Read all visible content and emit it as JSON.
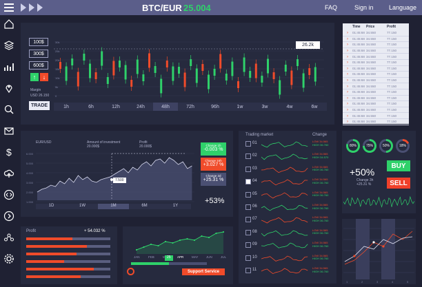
{
  "header": {
    "pair": "BTC/EUR",
    "price": "25.004",
    "nav": [
      "FAQ",
      "Sign in",
      "Language"
    ],
    "icons": [
      "menu-icon",
      "play-arrows-icon"
    ]
  },
  "sidebar": {
    "icons": [
      "home-icon",
      "layers-icon",
      "bar-chart-icon",
      "map-pin-icon",
      "search-icon",
      "mail-icon",
      "dollar-icon",
      "cloud-upload-icon",
      "code-icon",
      "chevron-right-icon",
      "share-icon",
      "gear-icon"
    ]
  },
  "trade_panel": {
    "amounts": [
      "100$",
      "300$",
      "600$"
    ],
    "margin_label": "Margin",
    "margin_value": "USD 26.150",
    "trade_label": "TRADE",
    "price_tag": "26.2k",
    "timeframes": [
      "1h",
      "6h",
      "12h",
      "24h",
      "48h",
      "72h",
      "96h",
      "1w",
      "3w",
      "4w",
      "6w"
    ],
    "selected_timeframe": "48h",
    "y_ticks": [
      "30k",
      "25k",
      "20k",
      "15k",
      "10k",
      "5k",
      "0"
    ]
  },
  "price_table": {
    "headers": [
      "Time",
      "Price",
      "Profit"
    ],
    "rows": [
      [
        "01:45:68",
        "34.550",
        "77.150"
      ],
      [
        "01:45:68",
        "34.550",
        "77.150"
      ],
      [
        "01:45:68",
        "34.550",
        "77.150"
      ],
      [
        "01:45:68",
        "34.550",
        "77.150"
      ],
      [
        "01:45:68",
        "34.550",
        "77.150"
      ],
      [
        "01:45:68",
        "34.550",
        "77.150"
      ],
      [
        "01:45:68",
        "34.550",
        "77.150"
      ],
      [
        "01:45:68",
        "34.550",
        "77.150"
      ],
      [
        "01:45:68",
        "34.550",
        "77.150"
      ],
      [
        "01:45:68",
        "34.550",
        "77.150"
      ],
      [
        "01:45:68",
        "34.550",
        "77.150"
      ],
      [
        "01:45:68",
        "34.550",
        "77.150"
      ],
      [
        "01:45:68",
        "34.550",
        "77.150"
      ],
      [
        "01:45:68",
        "34.550",
        "77.150"
      ],
      [
        "01:45:68",
        "34.550",
        "77.150"
      ],
      [
        "01:45:68",
        "34.550",
        "77.150"
      ]
    ]
  },
  "investment_panel": {
    "pair_label": "EUR/USD",
    "amount_label": "Amount of investment",
    "amount_value": "20.000$",
    "profit_label": "Profit",
    "profit_value": "20.000$",
    "tooltip": "7.500",
    "change_cards": [
      {
        "label": "Change 1h",
        "value": "-0.003 %",
        "color": "#2fd16a"
      },
      {
        "label": "Change 24h",
        "value": "+3.027 %",
        "color": "#f04b2a"
      },
      {
        "label": "Change 2d",
        "value": "+25.31 %",
        "color": "#4a4f72"
      }
    ],
    "total_change": "+53%",
    "periods": [
      "1D",
      "1W",
      "1M",
      "6M",
      "1Y"
    ],
    "selected_period": "1M",
    "y_ticks": [
      "6.000",
      "5.000",
      "4.000",
      "3.000",
      "2.000",
      "1.000"
    ]
  },
  "trading_market": {
    "title": "Trading market",
    "change_title": "Change",
    "rows": [
      {
        "num": "01",
        "color": "#2fd16a",
        "low": "LOW 34.565",
        "high": "HIGH 36.760"
      },
      {
        "num": "02",
        "color": "#2fd16a",
        "low": "LOW 34.565",
        "high": "HIGH 34.570"
      },
      {
        "num": "03",
        "color": "#f04b2a",
        "low": "LOW 34.565",
        "high": "HIGH 36.760"
      },
      {
        "num": "04",
        "color": "#f04b2a",
        "low": "LOW 34.565",
        "high": "HIGH 36.760"
      },
      {
        "num": "05",
        "color": "#f04b2a",
        "low": "LOW 34.565",
        "high": "HIGH 36.760"
      },
      {
        "num": "06",
        "color": "#2fd16a",
        "low": "LOW 34.565",
        "high": "HIGH 36.760"
      },
      {
        "num": "07",
        "color": "#f04b2a",
        "low": "LOW 34.565",
        "high": "HIGH 36.760"
      },
      {
        "num": "08",
        "color": "#2fd16a",
        "low": "LOW 34.565",
        "high": "HIGH 36.760"
      },
      {
        "num": "09",
        "color": "#2fd16a",
        "low": "LOW 34.565",
        "high": "HIGH 36.760"
      },
      {
        "num": "10",
        "color": "#f04b2a",
        "low": "LOW 34.565",
        "high": "HIGH 36.760"
      },
      {
        "num": "11",
        "color": "#f04b2a",
        "low": "LOW 34.565",
        "high": "HIGH 36.760"
      }
    ],
    "checked": [
      false,
      false,
      false,
      true,
      false,
      false,
      false,
      false,
      false,
      false,
      false
    ]
  },
  "signal_panel": {
    "rings": [
      "80%",
      "75%",
      "50%",
      "18%"
    ],
    "big_percent": "+50%",
    "change_label": "Change 3h",
    "change_value": "+25.31 %",
    "buy_label": "BUY",
    "sell_label": "SELL"
  },
  "profit_panel": {
    "title": "Profit",
    "value": "+ 54.032 %",
    "bars": [
      0.55,
      0.72,
      0.6,
      0.45,
      0.8,
      0.65
    ]
  },
  "month_chart": {
    "months": [
      "JAN",
      "FEB",
      "MAR",
      "APR",
      "MAY",
      "JUN",
      "JUL"
    ],
    "highlight": "APR",
    "slider_label": "25",
    "slider_value": 0.5
  },
  "support": {
    "label": "Support Service"
  },
  "bottom_right_ticks": [
    "1",
    "2",
    "3",
    "4",
    "5"
  ]
}
